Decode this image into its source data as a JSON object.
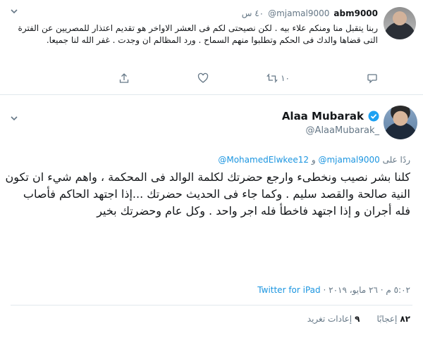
{
  "top_tweet": {
    "name": "abm9000",
    "handle": "@mjamal9000",
    "time": "٤٠ س",
    "text": "ربنا يتقبل منا ومنكم علاء بيه . لكن نصيحتى لكم فى العشر الاواخر هو تقديم اعتذار للمصريين عن الفترة التى قضاها والدك فى الحكم وتطلبوا منهم السماح . ورد المظالم ان وجدت . غفر الله لنا جميعا.",
    "retweet_count": "١٠",
    "icons": [
      "reply-icon",
      "retweet-icon",
      "like-icon",
      "share-icon",
      "more-icon"
    ]
  },
  "main_tweet": {
    "name": "Alaa Mubarak",
    "handle": "@AlaaMubarak_",
    "replying_prefix": "ردًا على",
    "mention_1": "@mjamal9000",
    "mention_joiner": "و",
    "mention_2": "@MohamedElwkee12",
    "text": "كلنا بشر نصيب ونخطىء وارجع حضرتك لكلمة الوالد فى المحكمة ، واهم شيء ان تكون النية صالحة والقصد سليم . وكما جاء فى الحديث حضرتك ...إذا اجتهد الحاكم فأصاب فله أجران و إذا اجتهد فاخطأ فله اجر واحد . وكل عام وحضرتك بخير",
    "timestamp": "٥:٠٢ م · ٢٦ مايو، ٢٠١٩",
    "separator": "·",
    "source": "Twitter for iPad",
    "retweets_count": "٩",
    "retweets_label": "إعادات تغريد",
    "likes_count": "٨٢",
    "likes_label": "إعجابًا",
    "icons": [
      "verified-icon",
      "more-icon"
    ]
  },
  "colors": {
    "link": "#1b95e0",
    "secondary_text": "#657786",
    "primary_text": "#14171a",
    "divider": "#e1e8ed"
  }
}
